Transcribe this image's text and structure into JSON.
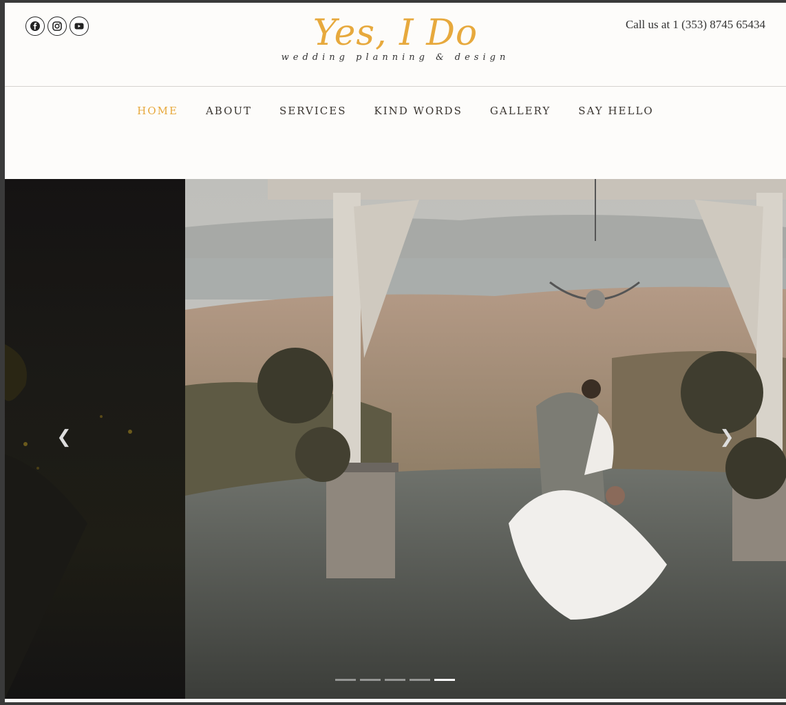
{
  "header": {
    "logo_main": "Yes, I Do",
    "logo_sub": "wedding planning & design",
    "phone": "Call us at 1 (353) 8745 65434",
    "social": [
      {
        "icon": "facebook-icon"
      },
      {
        "icon": "instagram-icon"
      },
      {
        "icon": "youtube-icon"
      }
    ]
  },
  "nav": {
    "items": [
      {
        "label": "HOME",
        "active": true
      },
      {
        "label": "ABOUT"
      },
      {
        "label": "SERVICES"
      },
      {
        "label": "KIND WORDS"
      },
      {
        "label": "GALLERY"
      },
      {
        "label": "SAY HELLO"
      }
    ]
  },
  "carousel": {
    "prev_icon": "chevron-left-icon",
    "next_icon": "chevron-right-icon",
    "slide_count": 5,
    "active_slide": 5
  },
  "colors": {
    "accent": "#e7a93d",
    "text": "#3a3530",
    "background": "#fdfcfa"
  }
}
